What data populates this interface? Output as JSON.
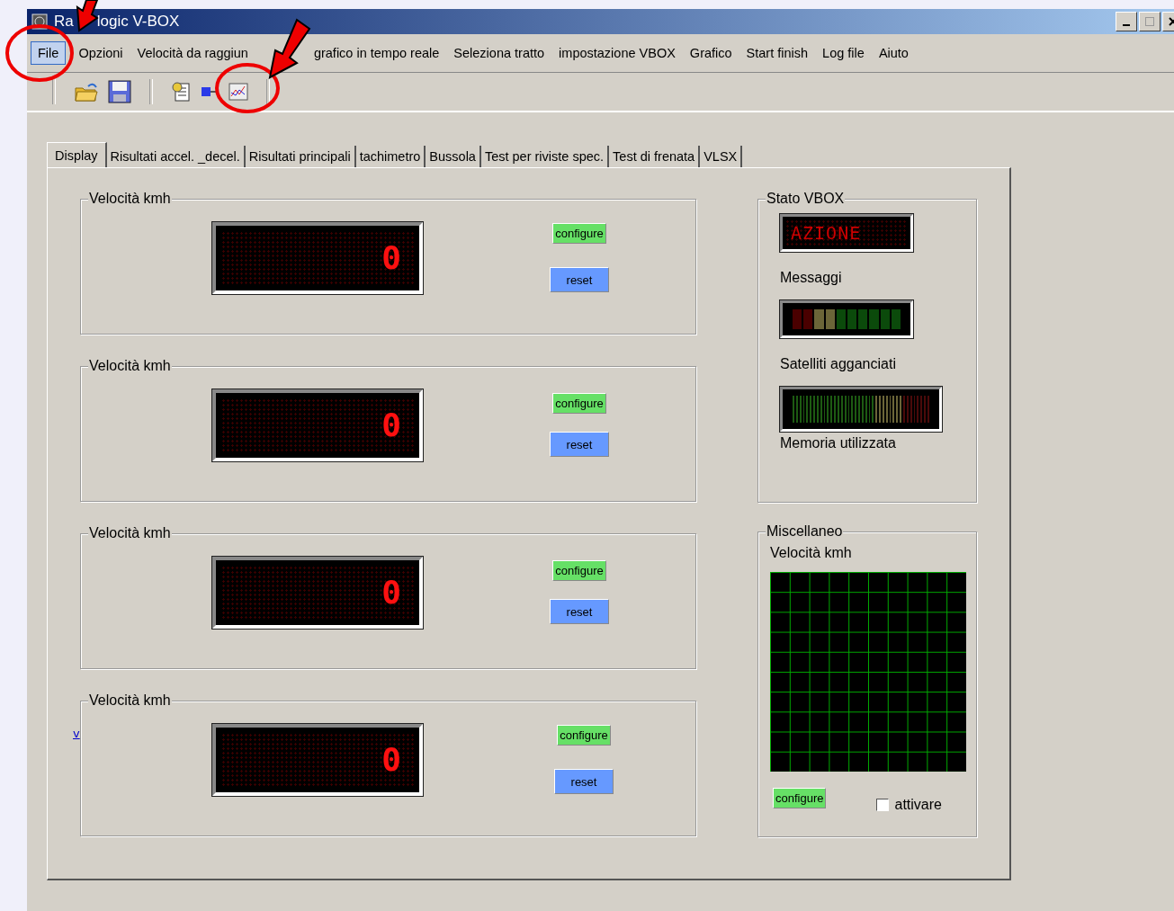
{
  "window": {
    "title_parts": [
      "Ra",
      "logic V-BOX"
    ]
  },
  "menu": [
    {
      "label": "File",
      "selected": true
    },
    {
      "label": "Opzioni",
      "selected": false
    },
    {
      "label": "Velocità da raggiun",
      "selected": false
    },
    {
      "label": "grafico in tempo reale",
      "selected": false
    },
    {
      "label": "Seleziona tratto",
      "selected": false
    },
    {
      "label": "impostazione VBOX",
      "selected": false
    },
    {
      "label": "Grafico",
      "selected": false
    },
    {
      "label": "Start finish",
      "selected": false
    },
    {
      "label": "Log file",
      "selected": false
    },
    {
      "label": "Aiuto",
      "selected": false
    }
  ],
  "tabs": [
    {
      "label": "Display",
      "selected": true
    },
    {
      "label": "Risultati accel. _decel.",
      "selected": false
    },
    {
      "label": "Risultati principali",
      "selected": false
    },
    {
      "label": "tachimetro",
      "selected": false
    },
    {
      "label": "Bussola",
      "selected": false
    },
    {
      "label": "Test per riviste spec.",
      "selected": false
    },
    {
      "label": "Test di frenata",
      "selected": false
    },
    {
      "label": "VLSX",
      "selected": false
    }
  ],
  "displays": [
    {
      "legend": "Velocità kmh",
      "reading": "0",
      "configure": "configure",
      "reset": "reset"
    },
    {
      "legend": "Velocità kmh",
      "reading": "0",
      "configure": "configure",
      "reset": "reset"
    },
    {
      "legend": "Velocità kmh",
      "reading": "0",
      "configure": "configure",
      "reset": "reset"
    },
    {
      "legend": "Velocità kmh",
      "reading": "0",
      "configure": "configure",
      "reset": "reset"
    }
  ],
  "side_link": "v",
  "status": {
    "legend": "Stato VBOX",
    "message": "AZIONE",
    "messages_label": "Messaggi",
    "satellites_label": "Satelliti agganciati",
    "memory_label": "Memoria utilizzata"
  },
  "misc": {
    "legend": "Miscellaneo",
    "chart_title": "Velocità kmh",
    "configure": "configure",
    "checkbox": {
      "label": "attivare",
      "checked": false
    }
  }
}
